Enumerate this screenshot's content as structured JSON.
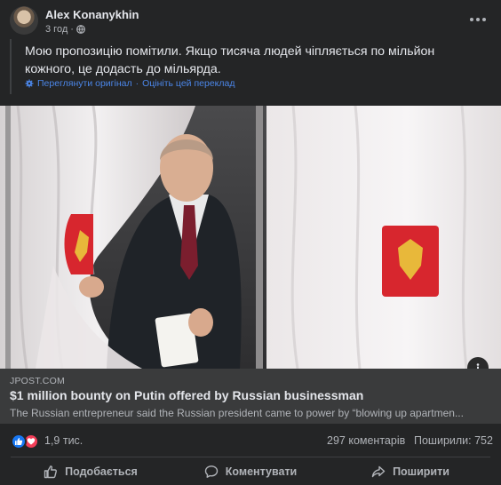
{
  "post": {
    "author": "Alex Konanykhin",
    "time": "3 год",
    "text": "Мою пропозицію помітили. Якщо тисяча людей чіпляється по мільйон кожного, це додасть до мільярда.",
    "see_original": "Переглянути оригінал",
    "separator": "·",
    "rate_translation": "Оцініть цей переклад"
  },
  "link": {
    "domain": "JPOST.COM",
    "title": "$1 million bounty on Putin offered by Russian businessman",
    "description": "The Russian entrepreneur said the Russian president came to power by “blowing up apartmen..."
  },
  "stats": {
    "reactions": "1,9 тис.",
    "comments": "297 коментарів",
    "shares": "Поширили: 752"
  },
  "actions": {
    "like": "Подобається",
    "comment": "Коментувати",
    "share": "Поширити"
  },
  "colors": {
    "background": "#242526",
    "link_blue": "#4b86e8",
    "like_blue": "#1877f2",
    "love_red": "#f33e58"
  }
}
